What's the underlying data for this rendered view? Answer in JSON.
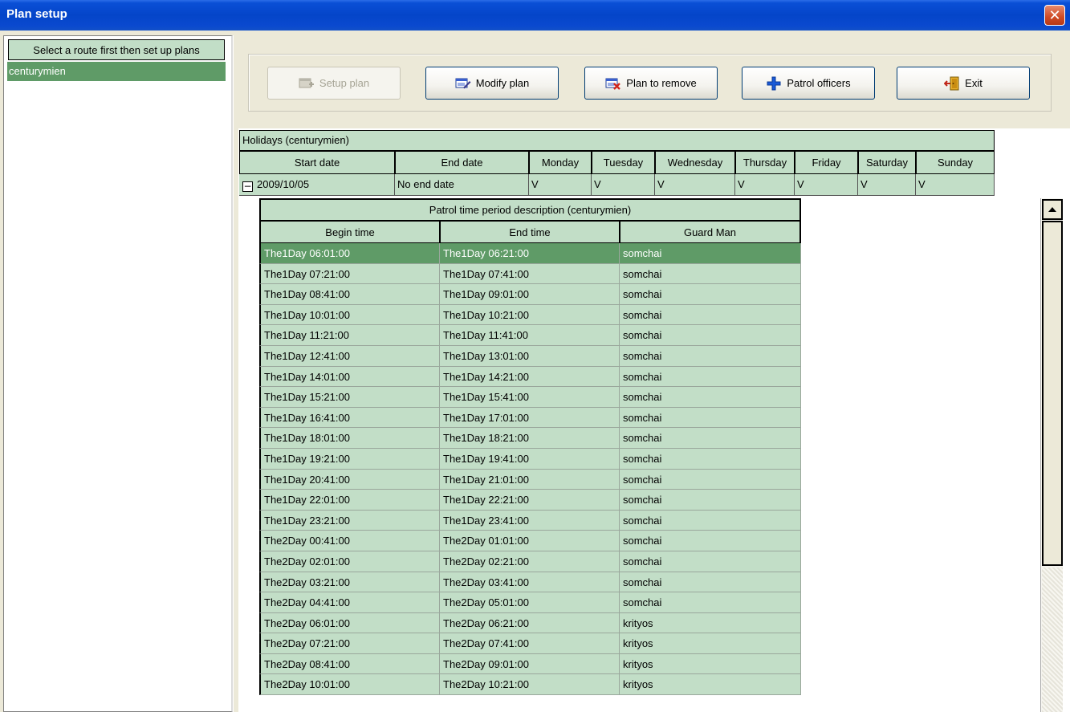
{
  "window": {
    "title": "Plan setup",
    "close_icon": "close-icon"
  },
  "left": {
    "header": "Select a route first then set up plans",
    "routes": [
      "centurymien"
    ]
  },
  "toolbar": {
    "setup_label": "Setup plan",
    "modify_label": "Modify plan",
    "remove_label": "Plan to remove",
    "officers_label": "Patrol officers",
    "exit_label": "Exit"
  },
  "holidays": {
    "title": "Holidays  (centurymien)",
    "columns": [
      "Start date",
      "End date",
      "Monday",
      "Tuesday",
      "Wednesday",
      "Thursday",
      "Friday",
      "Saturday",
      "Sunday"
    ],
    "row": [
      "2009/10/05",
      "No end date",
      "V",
      "V",
      "V",
      "V",
      "V",
      "V",
      "V"
    ]
  },
  "patrol": {
    "title": "Patrol time period description  (centurymien)",
    "columns": [
      "Begin time",
      "End time",
      "Guard Man"
    ],
    "rows": [
      [
        "The1Day  06:01:00",
        "The1Day  06:21:00",
        "somchai"
      ],
      [
        "The1Day  07:21:00",
        "The1Day  07:41:00",
        "somchai"
      ],
      [
        "The1Day  08:41:00",
        "The1Day  09:01:00",
        "somchai"
      ],
      [
        "The1Day  10:01:00",
        "The1Day  10:21:00",
        "somchai"
      ],
      [
        "The1Day  11:21:00",
        "The1Day  11:41:00",
        "somchai"
      ],
      [
        "The1Day  12:41:00",
        "The1Day  13:01:00",
        "somchai"
      ],
      [
        "The1Day  14:01:00",
        "The1Day  14:21:00",
        "somchai"
      ],
      [
        "The1Day  15:21:00",
        "The1Day  15:41:00",
        "somchai"
      ],
      [
        "The1Day  16:41:00",
        "The1Day  17:01:00",
        "somchai"
      ],
      [
        "The1Day  18:01:00",
        "The1Day  18:21:00",
        "somchai"
      ],
      [
        "The1Day  19:21:00",
        "The1Day  19:41:00",
        "somchai"
      ],
      [
        "The1Day  20:41:00",
        "The1Day  21:01:00",
        "somchai"
      ],
      [
        "The1Day  22:01:00",
        "The1Day  22:21:00",
        "somchai"
      ],
      [
        "The1Day  23:21:00",
        "The1Day  23:41:00",
        "somchai"
      ],
      [
        "The2Day  00:41:00",
        "The2Day  01:01:00",
        "somchai"
      ],
      [
        "The2Day  02:01:00",
        "The2Day  02:21:00",
        "somchai"
      ],
      [
        "The2Day  03:21:00",
        "The2Day  03:41:00",
        "somchai"
      ],
      [
        "The2Day  04:41:00",
        "The2Day  05:01:00",
        "somchai"
      ],
      [
        "The2Day  06:01:00",
        "The2Day  06:21:00",
        "krityos"
      ],
      [
        "The2Day  07:21:00",
        "The2Day  07:41:00",
        "krityos"
      ],
      [
        "The2Day  08:41:00",
        "The2Day  09:01:00",
        "krityos"
      ],
      [
        "The2Day  10:01:00",
        "The2Day  10:21:00",
        "krityos"
      ]
    ]
  }
}
